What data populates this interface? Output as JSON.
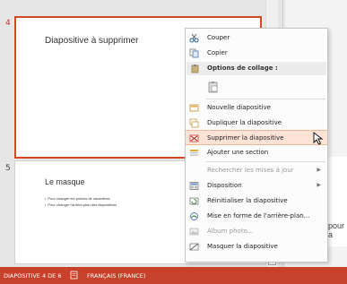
{
  "slides": [
    {
      "number": "4",
      "title": "Diapositive à supprimer"
    },
    {
      "number": "5",
      "title": "Le masque",
      "bullets": [
        "Pour changer les polices de caractères",
        "Pour changer l'arrière-plan des diapositives"
      ]
    }
  ],
  "right_partial_text": "pour a",
  "context_menu": {
    "cut": "Couper",
    "copy": "Copier",
    "paste_options": "Options de collage :",
    "new_slide": "Nouvelle diapositive",
    "duplicate": "Dupliquer la diapositive",
    "delete": "Supprimer la diapositive",
    "add_section": "Ajouter une section",
    "check_updates": "Rechercher les mises à jour",
    "layout": "Disposition",
    "reset": "Réinitialiser la diapositive",
    "format_background": "Mise en forme de l'arrière-plan...",
    "photo_album": "Album photo...",
    "hide_slide": "Masquer la diapositive"
  },
  "status": {
    "slide_info": "DIAPOSITIVE 4 DE 6",
    "language": "FRANÇAIS (FRANCE)"
  },
  "colors": {
    "accent": "#c8412a",
    "highlight": "#fde3d6",
    "selection_border": "#d24726"
  },
  "icons": {
    "cut": "scissors-icon",
    "copy": "copy-icon",
    "paste": "paste-icon",
    "new_slide": "new-slide-icon",
    "duplicate": "duplicate-icon",
    "delete": "delete-slide-icon",
    "section": "section-icon",
    "layout": "layout-icon",
    "reset": "reset-icon",
    "background": "background-icon",
    "album": "photo-album-icon",
    "hide": "hide-slide-icon"
  }
}
